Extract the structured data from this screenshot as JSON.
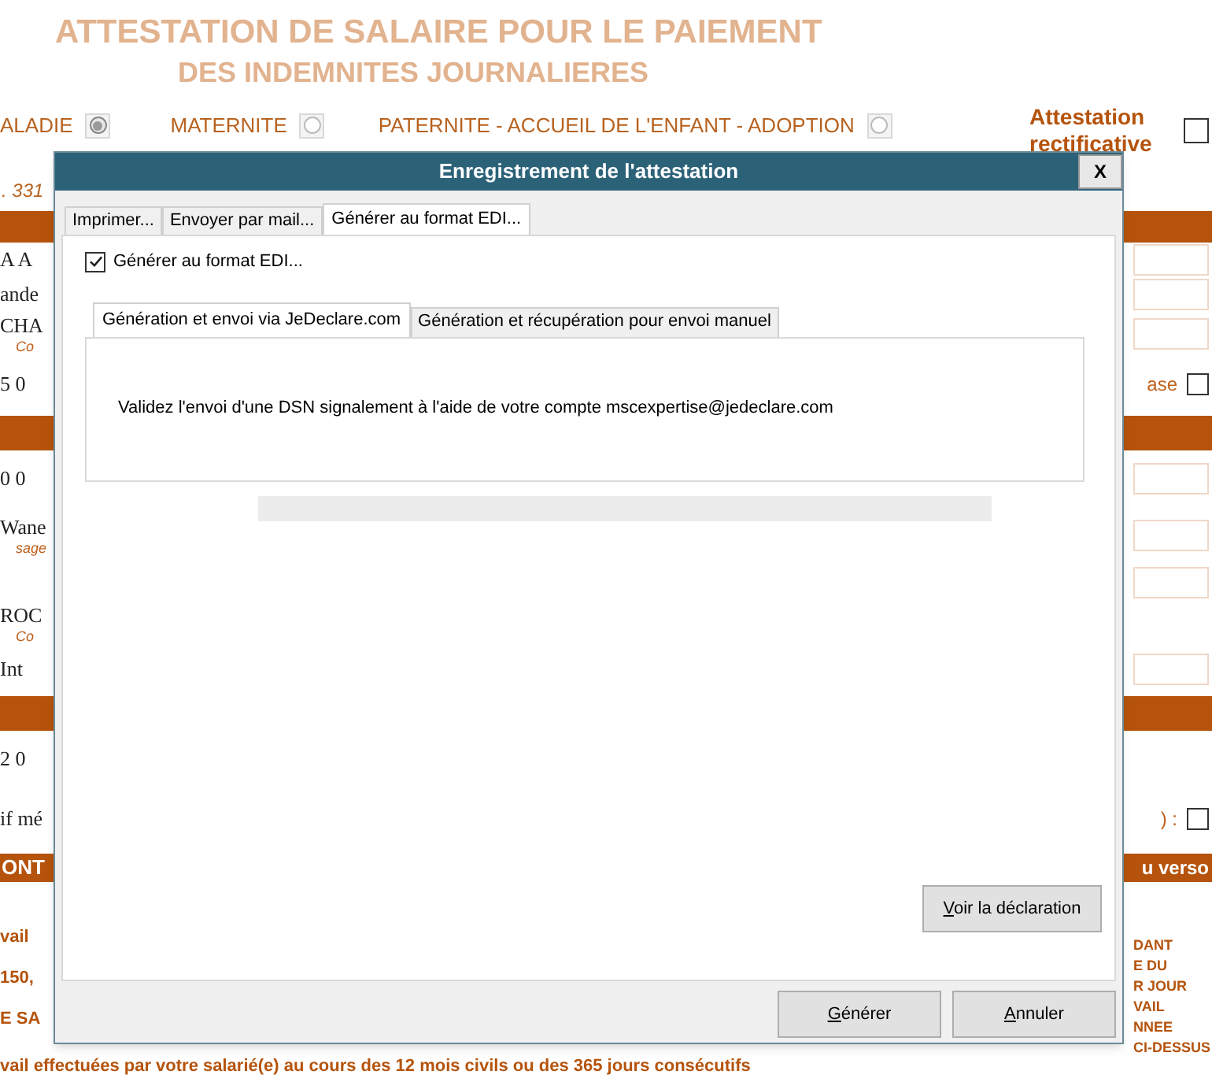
{
  "form": {
    "title_lines": [
      "ATTESTATION DE SALAIRE POUR LE PAIEMENT",
      "DES INDEMNITES JOURNALIERES"
    ],
    "reasons": [
      {
        "label": "ALADIE",
        "selected": true
      },
      {
        "label": "MATERNITE",
        "selected": false
      },
      {
        "label": "PATERNITE - ACCUEIL DE L'ENFANT - ADOPTION",
        "selected": false
      }
    ],
    "rectificative": {
      "label": "Attestation rectificative",
      "checked": false
    },
    "rows": [
      {
        "kind": "note",
        "left": ". 331"
      },
      {
        "kind": "bar"
      },
      {
        "kind": "entry",
        "left": "A A"
      },
      {
        "kind": "entry",
        "left": "ande"
      },
      {
        "kind": "entry",
        "left": "CHA",
        "sub": "Co"
      },
      {
        "kind": "line",
        "left": "5 0",
        "right_label": "ase",
        "checked": false
      },
      {
        "kind": "bar"
      },
      {
        "kind": "entry",
        "left": "0 0"
      },
      {
        "kind": "entry",
        "left": "Wane",
        "sub": "sage"
      },
      {
        "kind": "entry"
      },
      {
        "kind": "line",
        "left": "ROC",
        "sub": "Co"
      },
      {
        "kind": "entry",
        "left": "Int"
      },
      {
        "kind": "bar"
      },
      {
        "kind": "line",
        "left": "2 0"
      },
      {
        "kind": "line",
        "left": "if mé",
        "right_label": ") :",
        "checked": false
      },
      {
        "kind": "bar",
        "left": "ONT",
        "right": "u verso"
      }
    ],
    "bottom_lines": [
      "vail",
      "150,",
      "E SA"
    ],
    "bottom_sentence": "vail effectuées par votre salarié(e) au cours des 12 mois civils ou des 365 jours consécutifs",
    "side_words": [
      "DANT",
      "E DU",
      "R JOUR",
      "VAIL",
      "NNEE",
      "CI-DESSUS"
    ]
  },
  "dialog": {
    "title": "Enregistrement de l'attestation",
    "close": "X",
    "tabs": [
      {
        "label": "Imprimer...",
        "selected": false
      },
      {
        "label": "Envoyer par mail...",
        "selected": false
      },
      {
        "label": "Générer au format EDI...",
        "selected": true
      }
    ],
    "edi_checkbox": {
      "label": "Générer au format EDI...",
      "checked": true
    },
    "sub_tabs": [
      {
        "label": "Génération et envoi via JeDeclare.com",
        "selected": true
      },
      {
        "label": "Génération et récupération pour envoi manuel",
        "selected": false
      }
    ],
    "message": "Validez l'envoi d'une DSN signalement à l'aide de votre compte mscexpertise@jedeclare.com",
    "view_button": "Voir la déclaration",
    "buttons": [
      "Générer",
      "Annuler"
    ]
  }
}
